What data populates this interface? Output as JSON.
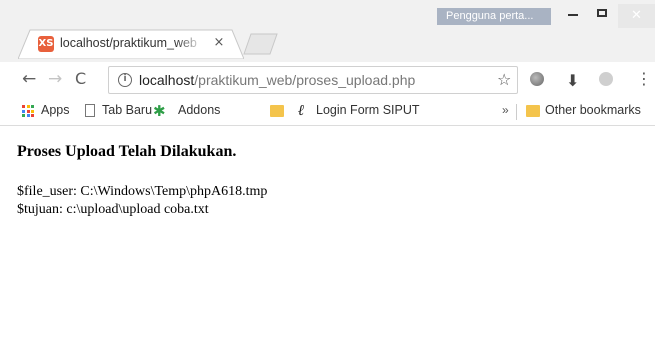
{
  "window": {
    "profile_label": "Pengguna perta...",
    "minimize_symbol": "",
    "close_symbol": "✕"
  },
  "tab": {
    "favicon_text": "XS",
    "title": "localhost/praktikum_web",
    "close_symbol": "×"
  },
  "toolbar": {
    "back_symbol": "←",
    "forward_symbol": "→",
    "reload_symbol": "C",
    "info_symbol": "i",
    "url_host": "localhost",
    "url_path": "/praktikum_web/proses_upload.php",
    "star_symbol": "☆",
    "download_symbol": "⬇",
    "menu_symbol": "⋮"
  },
  "bookmarks": {
    "items": [
      {
        "label": "Apps",
        "icon": "apps-grid-icon"
      },
      {
        "label": "Tab Baru",
        "icon": "page-icon"
      },
      {
        "label": "Addons",
        "icon": "puzzle-icon"
      },
      {
        "label": "",
        "icon": "folder-icon"
      },
      {
        "label": "Login Form SIPUT",
        "icon": "script-icon"
      }
    ],
    "overflow_symbol": "»",
    "other_label": "Other bookmarks",
    "puzzle_symbol": "✱",
    "script_symbol": "ℓ"
  },
  "page": {
    "heading": "Proses Upload Telah Dilakukan.",
    "line1": "$file_user: C:\\Windows\\Temp\\phpA618.tmp",
    "line2": "$tujuan: c:\\upload\\upload coba.txt"
  },
  "colors": {
    "apps_grid": [
      "#ea4335",
      "#fbbc05",
      "#34a853",
      "#4285f4",
      "#ea4335",
      "#fbbc05",
      "#34a853",
      "#4285f4",
      "#ea4335"
    ],
    "folder": "#f4c44c",
    "favicon": "#e8603c",
    "profile_bg": "#a9b3c3"
  }
}
